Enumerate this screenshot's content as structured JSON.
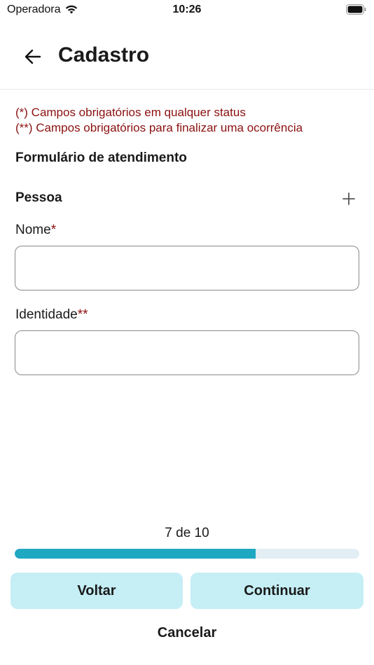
{
  "status_bar": {
    "carrier": "Operadora",
    "time": "10:26"
  },
  "header": {
    "title": "Cadastro"
  },
  "notes": {
    "line1": "(*) Campos obrigatórios em qualquer status",
    "line2": "(**) Campos obrigatórios para finalizar uma ocorrência"
  },
  "form": {
    "section_title": "Formulário de atendimento",
    "person_label": "Pessoa",
    "fields": [
      {
        "label": "Nome",
        "required_marker": "*",
        "value": ""
      },
      {
        "label": "Identidade",
        "required_marker": "**",
        "value": ""
      }
    ]
  },
  "progress": {
    "label": "7 de 10",
    "current": 7,
    "total": 10
  },
  "buttons": {
    "back_label": "Voltar",
    "continue_label": "Continuar",
    "cancel_label": "Cancelar"
  },
  "colors": {
    "required": "#8b1010",
    "progress_fill": "#1ea8c2",
    "progress_track": "#e3eef4",
    "button_bg": "#c5eef5"
  },
  "icons": {
    "back": "arrow-left-icon",
    "add": "plus-icon",
    "wifi": "wifi-icon",
    "battery": "battery-icon"
  }
}
